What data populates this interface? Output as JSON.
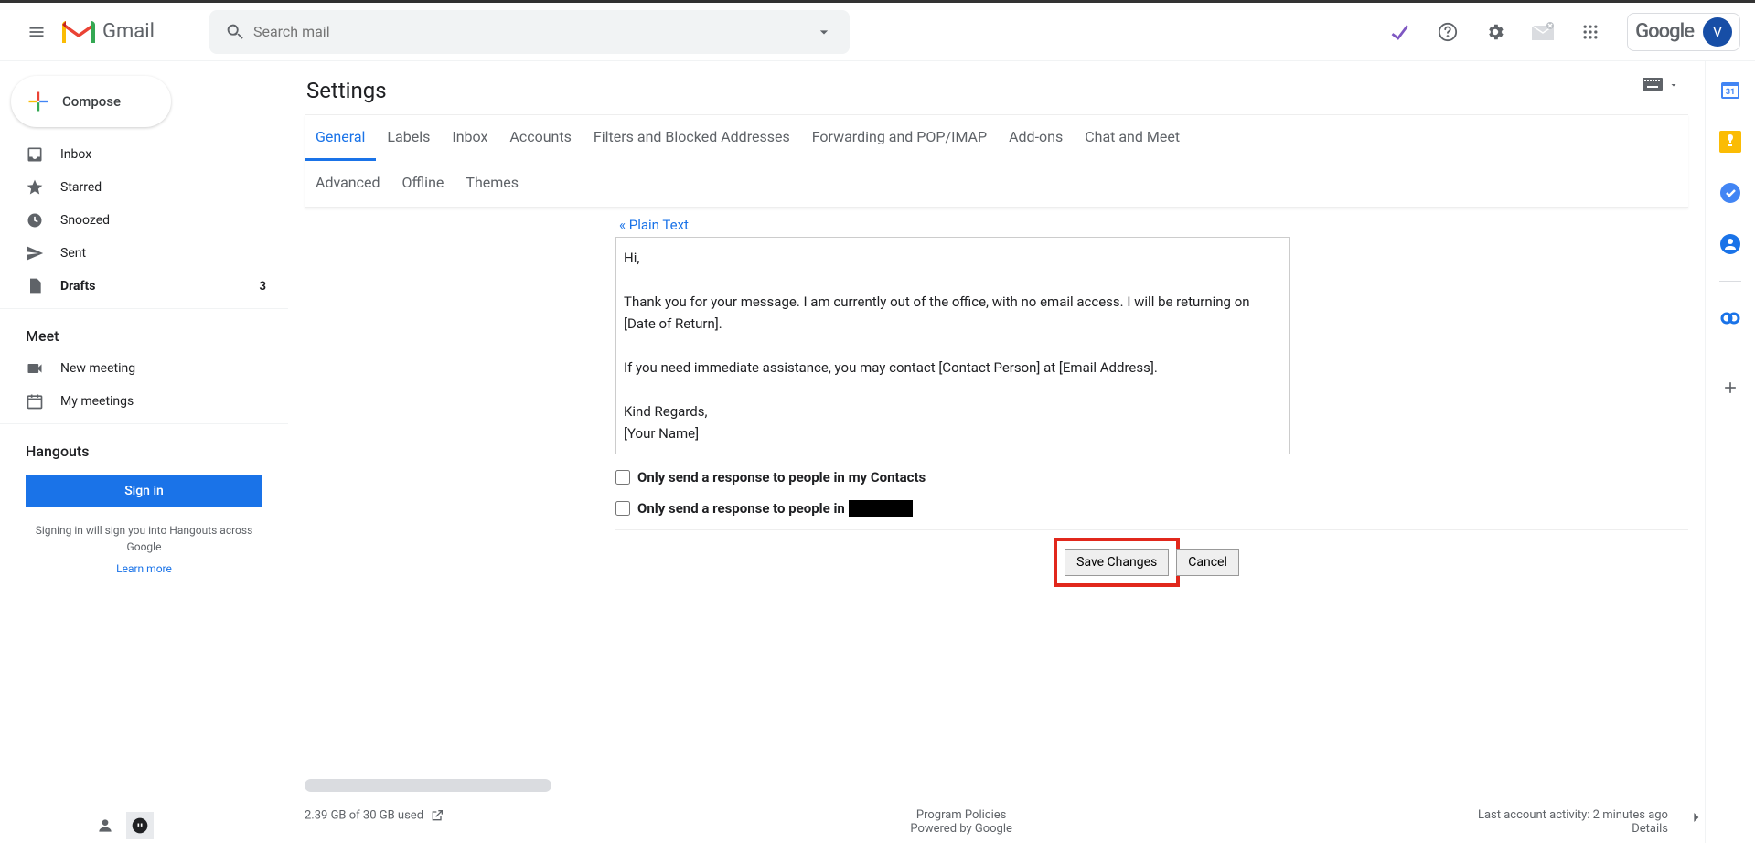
{
  "header": {
    "app_name": "Gmail",
    "search_placeholder": "Search mail",
    "avatar_letter": "V",
    "google_label": "Google"
  },
  "sidebar": {
    "compose": "Compose",
    "items": [
      {
        "label": "Inbox",
        "count": ""
      },
      {
        "label": "Starred",
        "count": ""
      },
      {
        "label": "Snoozed",
        "count": ""
      },
      {
        "label": "Sent",
        "count": ""
      },
      {
        "label": "Drafts",
        "count": "3"
      }
    ],
    "meet_header": "Meet",
    "meet_items": [
      {
        "label": "New meeting"
      },
      {
        "label": "My meetings"
      }
    ],
    "hangouts_header": "Hangouts",
    "signin": "Sign in",
    "signin_desc": "Signing in will sign you into Hangouts across Google",
    "learn_more": "Learn more"
  },
  "settings": {
    "title": "Settings",
    "tabs": [
      "General",
      "Labels",
      "Inbox",
      "Accounts",
      "Filters and Blocked Addresses",
      "Forwarding and POP/IMAP",
      "Add-ons",
      "Chat and Meet",
      "Advanced",
      "Offline",
      "Themes"
    ],
    "plain_text": "« Plain Text",
    "vacation_body": "Hi,\n\nThank you for your message. I am currently out of the office, with no email access. I will be returning on [Date of Return].\n\nIf you need immediate assistance, you may contact [Contact Person] at [Email Address].\n\nKind Regards,\n[Your Name]",
    "only_contacts": "Only send a response to people in my Contacts",
    "only_org": "Only send a response to people in",
    "save": "Save Changes",
    "cancel": "Cancel"
  },
  "footer": {
    "storage": "2.39 GB of 30 GB used",
    "policies": "Program Policies",
    "powered": "Powered by Google",
    "activity": "Last account activity: 2 minutes ago",
    "details": "Details"
  }
}
